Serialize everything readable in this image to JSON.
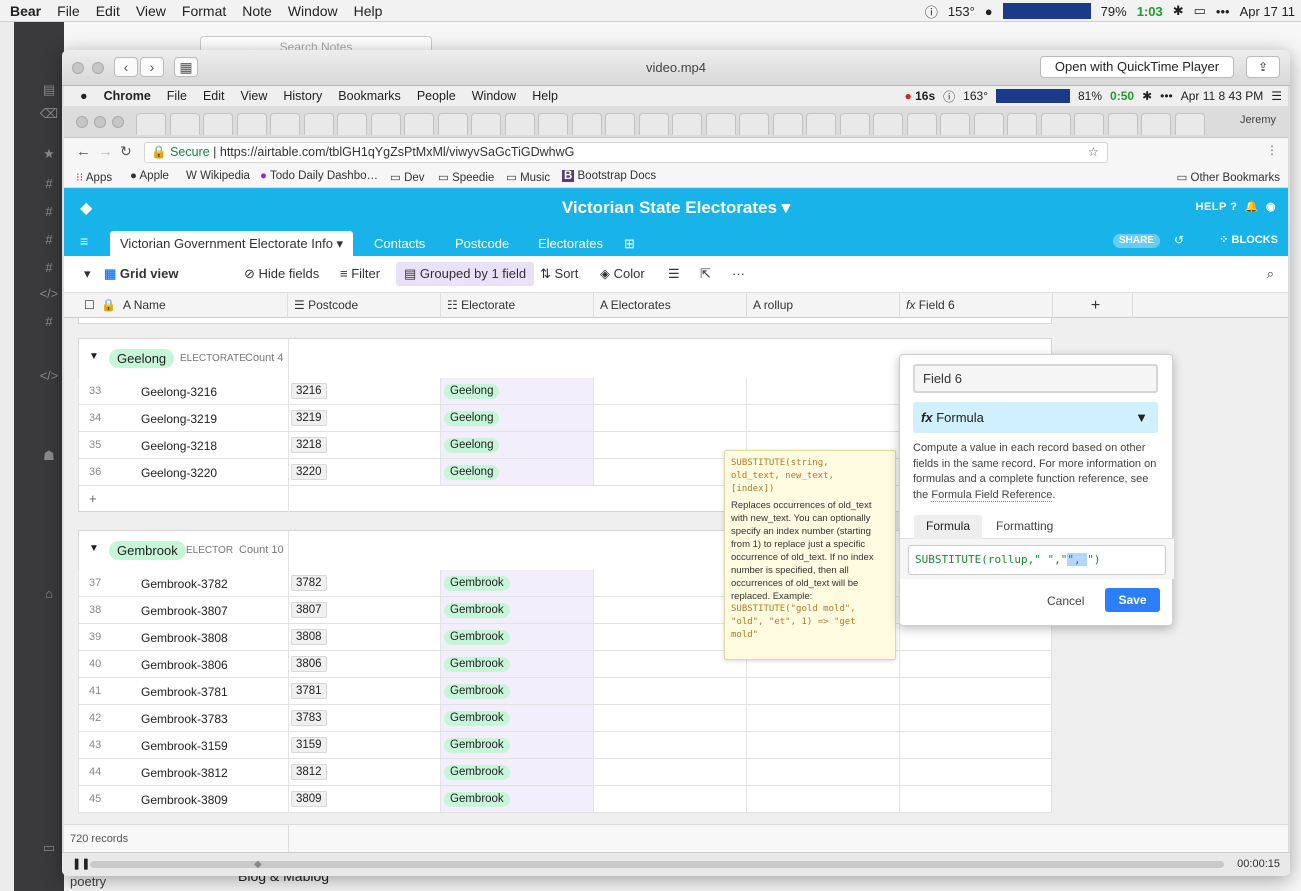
{
  "outer_menubar": {
    "app": "Bear",
    "items": [
      "File",
      "Edit",
      "View",
      "Format",
      "Note",
      "Window",
      "Help"
    ],
    "temp": "153°",
    "battery": "79%",
    "battery_time": "1:03",
    "datetime": "Apr 17  11"
  },
  "bear": {
    "search_placeholder": "Search Notes",
    "bottom_note": "Blog & Mablog",
    "poetry": "poetry"
  },
  "quicktime": {
    "title": "video.mp4",
    "open_button": "Open with QuickTime Player",
    "time": "00:00:15"
  },
  "inner_menubar": {
    "app": "Chrome",
    "items": [
      "File",
      "Edit",
      "View",
      "History",
      "Bookmarks",
      "People",
      "Window",
      "Help"
    ],
    "rec": "16s",
    "temp": "163°",
    "battery": "81%",
    "battery_time": "0:50",
    "datetime": "Apr 11  8 43 PM"
  },
  "chrome": {
    "profile": "Jeremy",
    "secure": "Secure",
    "url": "https://airtable.com/tblGH1qYgZsPtMxMl/viwyvSaGcTiGDwhwG",
    "bookmarks": [
      "Apps",
      "Apple",
      "Wikipedia",
      "Todo Daily Dashbo…",
      "Dev",
      "Speedie",
      "Music",
      "Bootstrap Docs"
    ],
    "other_bookmarks": "Other Bookmarks"
  },
  "airtable": {
    "base_title": "Victorian State Electorates ▾",
    "help": "HELP",
    "share": "SHARE",
    "blocks": "BLOCKS",
    "tabs": [
      "Victorian Government Electorate Info",
      "Contacts",
      "Postcode",
      "Electorates"
    ],
    "view": "Grid view",
    "hide_fields": "Hide fields",
    "filter": "Filter",
    "grouped": "Grouped by 1 field",
    "sort": "Sort",
    "color": "Color",
    "columns": [
      "Name",
      "Postcode",
      "Electorate",
      "Electorates",
      "rollup",
      "Field 6"
    ],
    "groups": [
      {
        "name": "Geelong",
        "label": "ELECTORATE",
        "count": "Count 4",
        "rows": [
          [
            "33",
            "Geelong-3216",
            "3216",
            "Geelong"
          ],
          [
            "34",
            "Geelong-3219",
            "3219",
            "Geelong"
          ],
          [
            "35",
            "Geelong-3218",
            "3218",
            "Geelong"
          ],
          [
            "36",
            "Geelong-3220",
            "3220",
            "Geelong"
          ]
        ]
      },
      {
        "name": "Gembrook",
        "label": "ELECTOR",
        "count": "Count 10",
        "rows": [
          [
            "37",
            "Gembrook-3782",
            "3782",
            "Gembrook"
          ],
          [
            "38",
            "Gembrook-3807",
            "3807",
            "Gembrook"
          ],
          [
            "39",
            "Gembrook-3808",
            "3808",
            "Gembrook"
          ],
          [
            "40",
            "Gembrook-3806",
            "3806",
            "Gembrook"
          ],
          [
            "41",
            "Gembrook-3781",
            "3781",
            "Gembrook"
          ],
          [
            "42",
            "Gembrook-3783",
            "3783",
            "Gembrook"
          ],
          [
            "43",
            "Gembrook-3159",
            "3159",
            "Gembrook"
          ],
          [
            "44",
            "Gembrook-3812",
            "3812",
            "Gembrook"
          ],
          [
            "45",
            "Gembrook-3809",
            "3809",
            "Gembrook"
          ]
        ]
      }
    ],
    "records": "720 records",
    "tooltip": {
      "signature": "SUBSTITUTE(string,\nold_text, new_text,\n[index])",
      "desc": "Replaces occurrences of old_text with new_text. You can optionally specify an index number (starting from 1) to replace just a specific occurrence of old_text. If no index number is specified, then all occurrences of old_text will be replaced. Example:",
      "example": "SUBSTITUTE(\"gold mold\",\n\"old\", \"et\", 1) => \"get\nmold\""
    },
    "field_popup": {
      "name": "Field 6",
      "type": "Formula",
      "description": "Compute a value in each record based on other fields in the same record. For more information on formulas and a complete function reference, see the ",
      "link": "Formula Field Reference",
      "tab_formula": "Formula",
      "tab_formatting": "Formatting",
      "formula_pre": "SUBSTITUTE(rollup,\" \",\"",
      "formula_sel": "\", ",
      "formula_post": "\")",
      "cancel": "Cancel",
      "save": "Save"
    }
  }
}
